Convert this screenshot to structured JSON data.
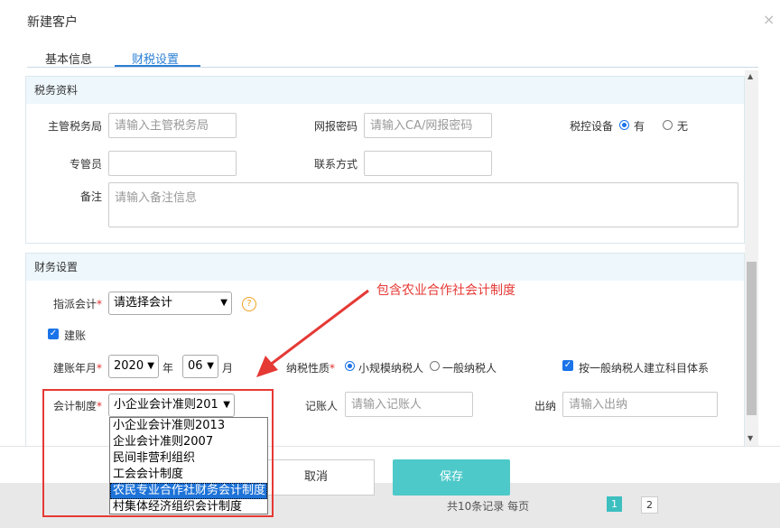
{
  "background": {
    "partial_text": "共10条记录 每页",
    "pager_current": "1",
    "pager_next": "2"
  },
  "dialog": {
    "title": "新建客户",
    "close_glyph": "×"
  },
  "tabs": [
    {
      "label": "基本信息"
    },
    {
      "label": "财税设置"
    }
  ],
  "tax_section": {
    "header": "税务资料",
    "tax_bureau_label": "主管税务局",
    "tax_bureau_placeholder": "请输入主管税务局",
    "online_pw_label": "网报密码",
    "online_pw_placeholder": "请输入CA/网报密码",
    "tax_device_label": "税控设备",
    "tax_device_yes": "有",
    "tax_device_no": "无",
    "officer_label": "专管员",
    "contact_label": "联系方式",
    "remark_label": "备注",
    "remark_placeholder": "请输入备注信息"
  },
  "finance_section": {
    "header": "财务设置",
    "assign_label": "指派会计",
    "assign_value": "请选择会计",
    "help_glyph": "?",
    "build_account_label": "建账",
    "build_date_label": "建账年月",
    "year_value": "2020",
    "year_unit": "年",
    "month_value": "06",
    "month_unit": "月",
    "taxpayer_label": "纳税性质",
    "taxpayer_small": "小规模纳税人",
    "taxpayer_general": "一般纳税人",
    "general_subject_label": "按一般纳税人建立科目体系",
    "accounting_label": "会计制度",
    "accounting_value": "小企业会计准则201",
    "bookkeeper_label": "记账人",
    "bookkeeper_placeholder": "请输入记账人",
    "cashier_label": "出纳",
    "cashier_placeholder": "请输入出纳"
  },
  "dropdown_options": [
    "小企业会计准则2013",
    "企业会计准则2007",
    "民间非营利组织",
    "工会会计制度",
    "农民专业合作社财务会计制度",
    "村集体经济组织会计制度"
  ],
  "footer": {
    "cancel": "取消",
    "save": "保存"
  },
  "annotation": "包含农业合作社会计制度",
  "colors": {
    "accent": "#1a73e8",
    "save_button": "#4ec9c9",
    "annotation_red": "#e53935"
  }
}
